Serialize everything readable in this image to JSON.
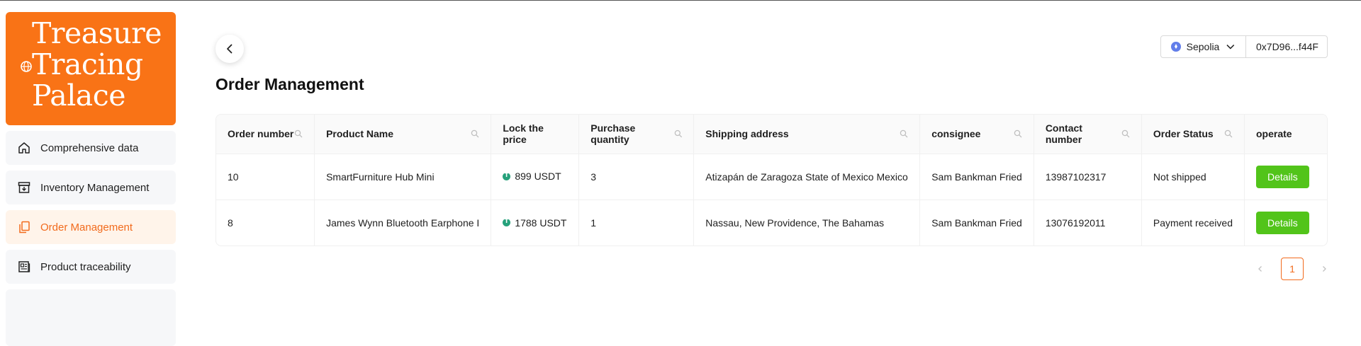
{
  "brand": {
    "line1": "Treasure",
    "line2": "Tracing",
    "line3": "Palace",
    "color": "#f97316"
  },
  "sidebar": {
    "items": [
      {
        "label": "Comprehensive data",
        "icon": "home-icon",
        "active": false
      },
      {
        "label": "Inventory Management",
        "icon": "archive-box-icon",
        "active": false
      },
      {
        "label": "Order Management",
        "icon": "documents-icon",
        "active": true
      },
      {
        "label": "Product traceability",
        "icon": "newspaper-icon",
        "active": false
      }
    ]
  },
  "header": {
    "title": "Order Management",
    "back_icon": "chevron-left-icon"
  },
  "wallet": {
    "network": "Sepolia",
    "address": "0x7D96...f44F"
  },
  "table": {
    "columns": [
      {
        "label": "Order number",
        "searchable": true
      },
      {
        "label": "Product Name",
        "searchable": true
      },
      {
        "label": "Lock the price",
        "searchable": false
      },
      {
        "label": "Purchase quantity",
        "searchable": true
      },
      {
        "label": "Shipping address",
        "searchable": true
      },
      {
        "label": "consignee",
        "searchable": true
      },
      {
        "label": "Contact number",
        "searchable": true
      },
      {
        "label": "Order Status",
        "searchable": true
      },
      {
        "label": "operate",
        "searchable": false
      }
    ],
    "rows": [
      {
        "order_number": "10",
        "product_name": "SmartFurniture Hub Mini",
        "price": "899 USDT",
        "quantity": "3",
        "address": "Atizapán de Zaragoza State of Mexico Mexico",
        "consignee": "Sam Bankman Fried",
        "contact": "13987102317",
        "status": "Not shipped",
        "action": "Details"
      },
      {
        "order_number": "8",
        "product_name": "James Wynn Bluetooth Earphone I",
        "price": "1788 USDT",
        "quantity": "1",
        "address": "Nassau, New Providence, The Bahamas",
        "consignee": "Sam Bankman Fried",
        "contact": "13076192011",
        "status": "Payment received",
        "action": "Details"
      }
    ]
  },
  "pagination": {
    "current_page": "1"
  },
  "colors": {
    "accent": "#f26b1d",
    "success": "#52c41a",
    "usdt": "#26a17b",
    "eth": "#627eea"
  }
}
